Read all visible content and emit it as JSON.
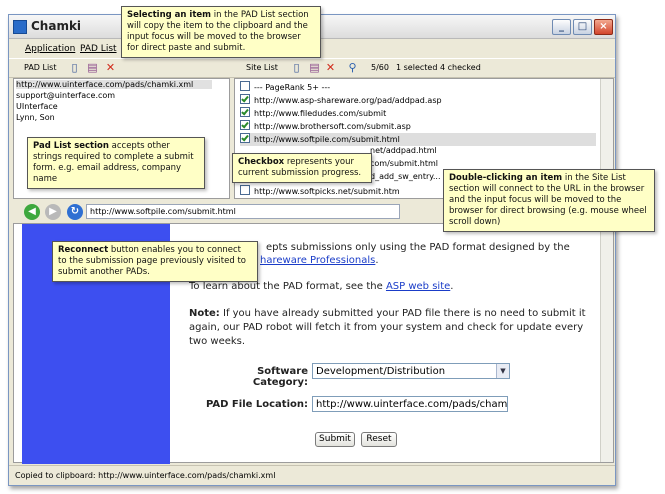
{
  "window": {
    "title": "Chamki"
  },
  "menu": {
    "application": "Application",
    "pad_list": "PAD List"
  },
  "toolbar": {
    "pad_list_label": "PAD List",
    "site_list_label": "Site List",
    "count": "5/60",
    "selected": "1 selected",
    "checked": "4 checked"
  },
  "pad_list": {
    "items": [
      "http://www.uinterface.com/pads/chamki.xml",
      "support@uinterface.com",
      "UInterface",
      "Lynn, Son"
    ]
  },
  "site_list": {
    "header": "--- PageRank 5+ ---",
    "rows": [
      {
        "url": "http://www.asp-shareware.org/pad/addpad.asp",
        "checked": true
      },
      {
        "url": "http://www.filedudes.com/submit",
        "checked": true
      },
      {
        "url": "http://www.brothersoft.com/submit.asp",
        "checked": true
      },
      {
        "url": "http://www.softpile.com/submit.html",
        "checked": true
      },
      {
        "url": "net/addpad.html",
        "checked": false
      },
      {
        "url": "com/submit.html",
        "checked": false
      },
      {
        "url": "d_add_sw_entry...",
        "checked": false
      },
      {
        "url": "http://www.softpicks.net/submit.htm",
        "checked": false
      }
    ]
  },
  "browser": {
    "url": "http://www.softpile.com/submit.html",
    "para1_tail": "epts submissions only using the PAD format designed by the",
    "para1_link": "hareware Professionals",
    "para1_end": ".",
    "para2_pre": "To learn about the PAD format, see the ",
    "para2_link": "ASP web site",
    "para2_end": ".",
    "note_label": "Note:",
    "note_line1": " If you have already submitted your PAD file there is no need to submit it",
    "note_line2": "again, our PAD robot will fetch it from your system and check for update every",
    "note_line3": "two weeks.",
    "category_label": "Software Category:",
    "category_value": "Development/Distribution",
    "location_label": "PAD File Location:",
    "location_value": "http://www.uinterface.com/pads/cham",
    "submit": "Submit",
    "reset": "Reset"
  },
  "status": {
    "text": "Copied to clipboard: http://www.uinterface.com/pads/chamki.xml"
  },
  "callouts": {
    "select_bold": "Selecting an item",
    "select_rest": " in the PAD List section will copy the item to the clipboard and the input focus will be moved to the browser for direct paste and submit.",
    "padlist_bold": "Pad List section",
    "padlist_rest": " accepts other strings required to complete a submit form. e.g. email address, company name",
    "checkbox_bold": "Checkbox",
    "checkbox_rest": " represents your current submission progress.",
    "dblclick_bold": "Double-clicking an item",
    "dblclick_rest": " in the Site List section will connect to the URL in the browser and the input focus will be moved to the browser for direct browsing (e.g. mouse wheel scroll down)",
    "reconnect_bold": "Reconnect",
    "reconnect_rest": " button enables you to connect to the submission page previously visited to submit another PADs."
  }
}
